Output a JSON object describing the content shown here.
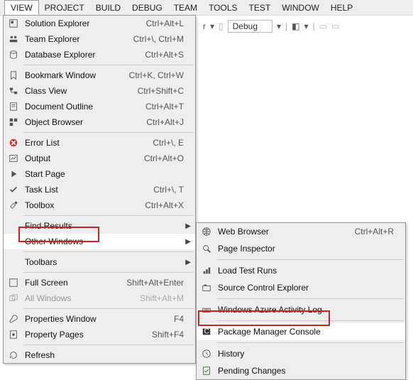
{
  "menubar": [
    "VIEW",
    "PROJECT",
    "BUILD",
    "DEBUG",
    "TEAM",
    "TOOLS",
    "TEST",
    "WINDOW",
    "HELP"
  ],
  "toolbar": {
    "suffix": "r",
    "config": "Debug"
  },
  "view_menu": [
    {
      "label": "Solution Explorer",
      "sc": "Ctrl+Alt+L",
      "icon": "sln"
    },
    {
      "label": "Team Explorer",
      "sc": "Ctrl+\\, Ctrl+M",
      "icon": "team"
    },
    {
      "label": "Database Explorer",
      "sc": "Ctrl+Alt+S",
      "icon": "db"
    },
    {
      "sep": true
    },
    {
      "label": "Bookmark Window",
      "sc": "Ctrl+K, Ctrl+W",
      "icon": "bm"
    },
    {
      "label": "Class View",
      "sc": "Ctrl+Shift+C",
      "icon": "cls"
    },
    {
      "label": "Document Outline",
      "sc": "Ctrl+Alt+T",
      "icon": "doc"
    },
    {
      "label": "Object Browser",
      "sc": "Ctrl+Alt+J",
      "icon": "obj"
    },
    {
      "sep": true
    },
    {
      "label": "Error List",
      "sc": "Ctrl+\\, E",
      "icon": "err"
    },
    {
      "label": "Output",
      "sc": "Ctrl+Alt+O",
      "icon": "out"
    },
    {
      "label": "Start Page",
      "sc": "",
      "icon": "start"
    },
    {
      "label": "Task List",
      "sc": "Ctrl+\\, T",
      "icon": "task"
    },
    {
      "label": "Toolbox",
      "sc": "Ctrl+Alt+X",
      "icon": "tbx"
    },
    {
      "sep": true
    },
    {
      "label": "Find Results",
      "sc": "",
      "icon": "",
      "sub": true
    },
    {
      "label": "Other Windows",
      "sc": "",
      "icon": "",
      "sub": true,
      "hover": true
    },
    {
      "sep": true
    },
    {
      "label": "Toolbars",
      "sc": "",
      "icon": "",
      "sub": true
    },
    {
      "sep": true
    },
    {
      "label": "Full Screen",
      "sc": "Shift+Alt+Enter",
      "icon": "full"
    },
    {
      "label": "All Windows",
      "sc": "Shift+Alt+M",
      "icon": "all",
      "dim": true
    },
    {
      "sep": true
    },
    {
      "label": "Properties Window",
      "sc": "F4",
      "icon": "prop"
    },
    {
      "label": "Property Pages",
      "sc": "Shift+F4",
      "icon": "pp"
    },
    {
      "sep": true
    },
    {
      "label": "Refresh",
      "sc": "",
      "icon": "ref"
    }
  ],
  "submenu": [
    {
      "label": "Web Browser",
      "sc": "Ctrl+Alt+R",
      "icon": "web"
    },
    {
      "label": "Page Inspector",
      "sc": "",
      "icon": "pi"
    },
    {
      "sep": true
    },
    {
      "label": "Load Test Runs",
      "sc": "",
      "icon": "lt"
    },
    {
      "label": "Source Control Explorer",
      "sc": "",
      "icon": "sce"
    },
    {
      "sep": true
    },
    {
      "label": "Windows Azure Activity Log",
      "sc": "",
      "icon": "az"
    },
    {
      "sep": true
    },
    {
      "label": "Package Manager Console",
      "sc": "",
      "icon": "pmc",
      "hover": true
    },
    {
      "sep": true
    },
    {
      "label": "History",
      "sc": "",
      "icon": "hist"
    },
    {
      "label": "Pending Changes",
      "sc": "",
      "icon": "pc"
    }
  ]
}
